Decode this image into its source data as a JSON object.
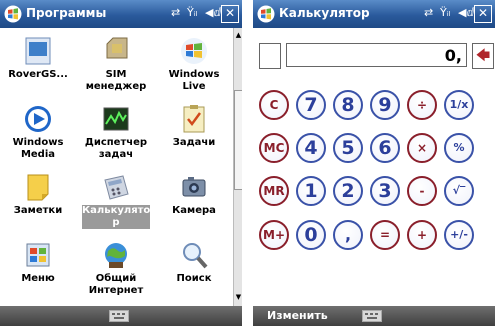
{
  "left": {
    "title": "Программы",
    "tray": {
      "signal": "⇄",
      "antenna": "Ÿᵢₗ",
      "volume": "◀ⅆ",
      "close": "✕"
    },
    "apps": [
      {
        "label": "RoverGS...",
        "icon": "rovergs-icon"
      },
      {
        "label": "SIM менеджер",
        "icon": "sim-card-icon"
      },
      {
        "label": "Windows Live",
        "icon": "windows-live-icon"
      },
      {
        "label": "Windows Media",
        "icon": "windows-media-icon"
      },
      {
        "label": "Диспетчер задач",
        "icon": "task-manager-icon"
      },
      {
        "label": "Задачи",
        "icon": "tasks-icon"
      },
      {
        "label": "Заметки",
        "icon": "notes-icon"
      },
      {
        "label": "Калькулято р",
        "icon": "calculator-icon",
        "selected": true
      },
      {
        "label": "Камера",
        "icon": "camera-icon"
      },
      {
        "label": "Меню",
        "icon": "menu-icon"
      },
      {
        "label": "Общий Интернет",
        "icon": "internet-sharing-icon"
      },
      {
        "label": "Поиск",
        "icon": "search-icon"
      }
    ]
  },
  "right": {
    "title": "Калькулятор",
    "display": "0,",
    "backspace": "🡄",
    "soft_left": "Изменить",
    "rows": [
      [
        {
          "t": "C",
          "red": true
        },
        {
          "t": "7"
        },
        {
          "t": "8"
        },
        {
          "t": "9"
        },
        {
          "t": "÷",
          "red": true
        },
        {
          "t": "1/x",
          "sm": true
        }
      ],
      [
        {
          "t": "MC",
          "red": true
        },
        {
          "t": "4"
        },
        {
          "t": "5"
        },
        {
          "t": "6"
        },
        {
          "t": "×",
          "red": true
        },
        {
          "t": "%",
          "sm": true
        }
      ],
      [
        {
          "t": "MR",
          "red": true
        },
        {
          "t": "1"
        },
        {
          "t": "2"
        },
        {
          "t": "3"
        },
        {
          "t": "-",
          "red": true
        },
        {
          "t": "√‾",
          "sm": true
        }
      ],
      [
        {
          "t": "M+",
          "red": true
        },
        {
          "t": "0"
        },
        {
          "t": ","
        },
        {
          "t": "=",
          "red": true
        },
        {
          "t": "+",
          "red": true
        },
        {
          "t": "+/-",
          "sm": true
        }
      ]
    ]
  }
}
